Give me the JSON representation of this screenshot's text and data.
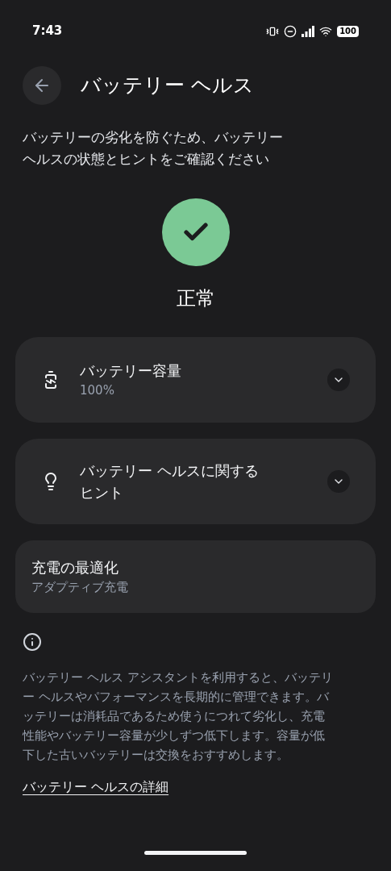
{
  "status_bar": {
    "time": "7:43",
    "battery": "100"
  },
  "header": {
    "title": "バッテリー ヘルス"
  },
  "description": "バッテリーの劣化を防ぐため、バッテリーヘルスの状態とヒントをご確認ください",
  "status": {
    "label": "正常",
    "color": "#7bc995"
  },
  "cards": [
    {
      "kind": "battery",
      "title": "バッテリー容量",
      "subtitle": "100%",
      "expanded": false
    },
    {
      "kind": "tip",
      "title": "バッテリー ヘルスに関するヒント",
      "expanded": false
    },
    {
      "kind": "plain",
      "title": "充電の最適化",
      "subtitle": "アダプティブ充電"
    }
  ],
  "info": {
    "text": "バッテリー ヘルス アシスタントを利用すると、バッテリー ヘルスやパフォーマンスを長期的に管理できます。バッテリーは消耗品であるため使うにつれて劣化し、充電性能やバッテリー容量が少しずつ低下します。容量が低下した古いバッテリーは交換をおすすめします。",
    "link": "バッテリー ヘルスの詳細"
  }
}
